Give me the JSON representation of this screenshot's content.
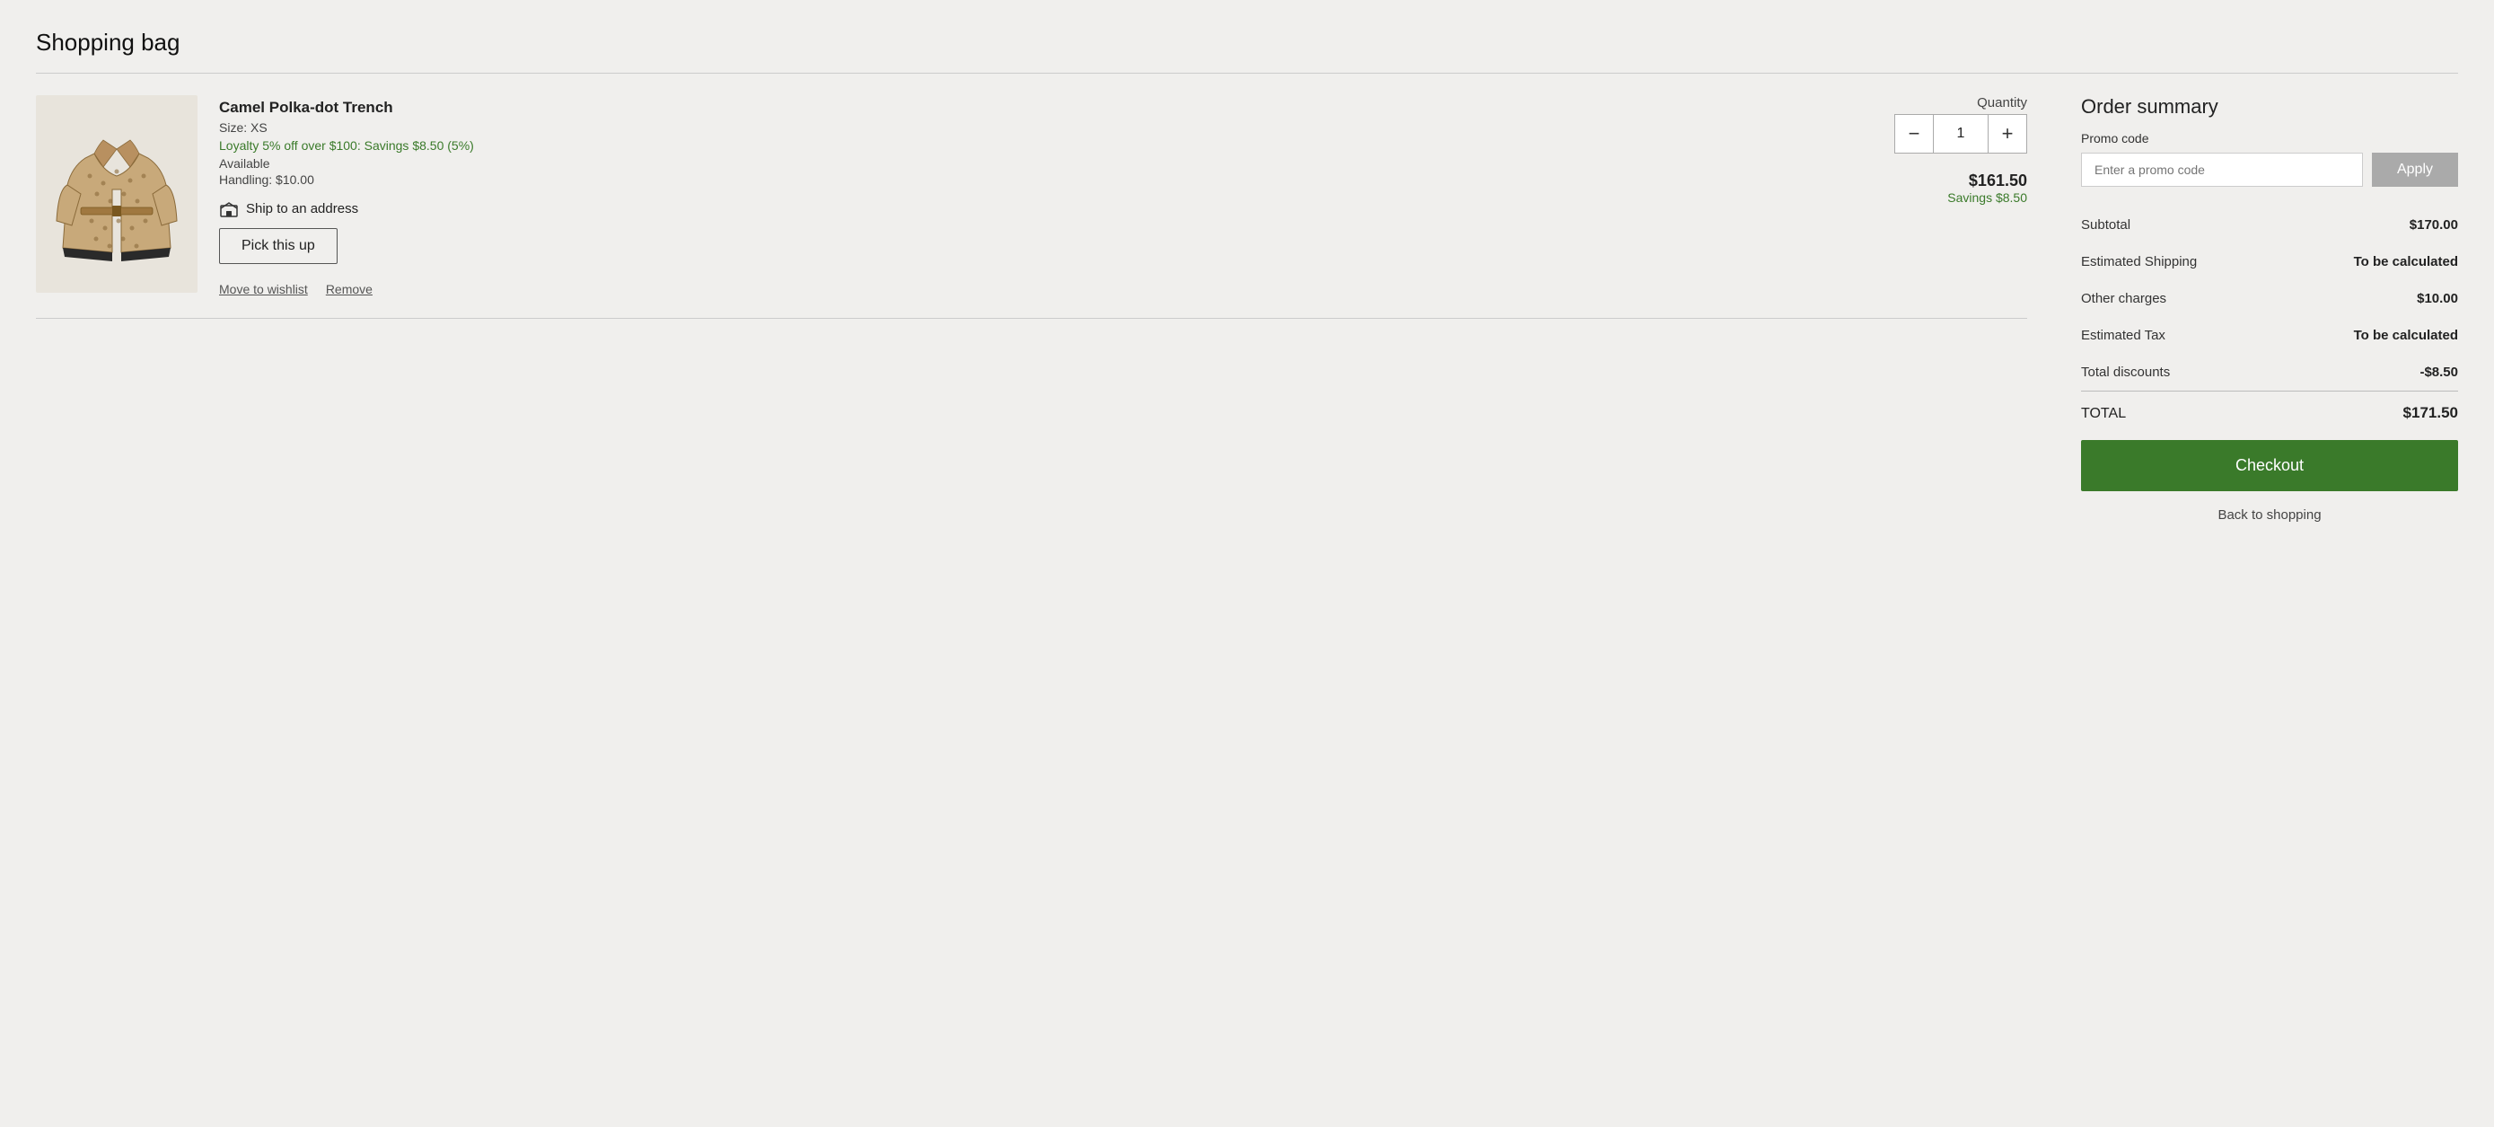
{
  "page": {
    "title": "Shopping bag"
  },
  "cart": {
    "items": [
      {
        "id": "item-1",
        "name": "Camel Polka-dot Trench",
        "size_label": "Size: XS",
        "loyalty_text": "Loyalty 5% off over $100: Savings $8.50 (5%)",
        "availability": "Available",
        "handling": "Handling: $10.00",
        "ship_label": "Ship to an address",
        "pickup_btn": "Pick this up",
        "quantity": 1,
        "price": "$161.50",
        "savings": "Savings $8.50",
        "move_wishlist": "Move to wishlist",
        "remove": "Remove",
        "quantity_label": "Quantity"
      }
    ]
  },
  "order_summary": {
    "title": "Order summary",
    "promo_label": "Promo code",
    "promo_placeholder": "Enter a promo code",
    "apply_btn": "Apply",
    "rows": [
      {
        "label": "Subtotal",
        "value": "$170.00",
        "bold": true
      },
      {
        "label": "Estimated Shipping",
        "value": "To be calculated",
        "bold": true
      },
      {
        "label": "Other charges",
        "value": "$10.00",
        "bold": true
      },
      {
        "label": "Estimated Tax",
        "value": "To be calculated",
        "bold": true
      },
      {
        "label": "Total discounts",
        "value": "-$8.50",
        "bold": false
      }
    ],
    "total_label": "TOTAL",
    "total_value": "$171.50",
    "checkout_btn": "Checkout",
    "back_shopping": "Back to shopping"
  },
  "icons": {
    "minus": "−",
    "plus": "+",
    "ship": "🏬"
  }
}
